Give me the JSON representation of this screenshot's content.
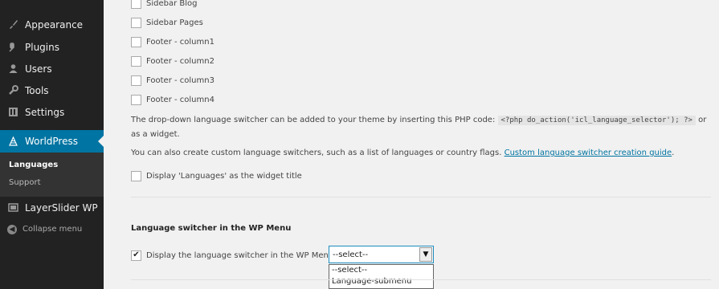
{
  "sidebar": {
    "items": [
      {
        "label": "Appearance",
        "icon": "paintbrush-icon"
      },
      {
        "label": "Plugins",
        "icon": "plug-icon"
      },
      {
        "label": "Users",
        "icon": "user-icon"
      },
      {
        "label": "Tools",
        "icon": "wrench-icon"
      },
      {
        "label": "Settings",
        "icon": "settings-icon"
      },
      {
        "label": "WorldPress",
        "icon": "globe-icon"
      },
      {
        "label": "LayerSlider WP",
        "icon": "layers-icon"
      }
    ],
    "submenu": [
      "Languages",
      "Support"
    ],
    "collapse_label": "Collapse menu",
    "accent_color": "#0074a2"
  },
  "main": {
    "widget_areas": [
      {
        "label": "Sidebar Blog",
        "checked": false
      },
      {
        "label": "Sidebar Pages",
        "checked": false
      },
      {
        "label": "Footer - column1",
        "checked": false
      },
      {
        "label": "Footer - column2",
        "checked": false
      },
      {
        "label": "Footer - column3",
        "checked": false
      },
      {
        "label": "Footer - column4",
        "checked": false
      }
    ],
    "php_note_before": "The drop-down language switcher can be added to your theme by inserting this PHP code:",
    "php_code": "<?php do_action('icl_language_selector'); ?>",
    "php_note_after": "or as a widget.",
    "custom_note": "You can also create custom language switchers, such as a list of languages or country flags.",
    "custom_link": "Custom language switcher creation guide",
    "display_title_label": "Display 'Languages' as the widget title",
    "section_title": "Language switcher in the WP Menu",
    "menu_switch_label": "Display the language switcher in the WP Menu",
    "select_value": "--select--",
    "select_options": [
      "--select--",
      "Language-submenu"
    ]
  }
}
